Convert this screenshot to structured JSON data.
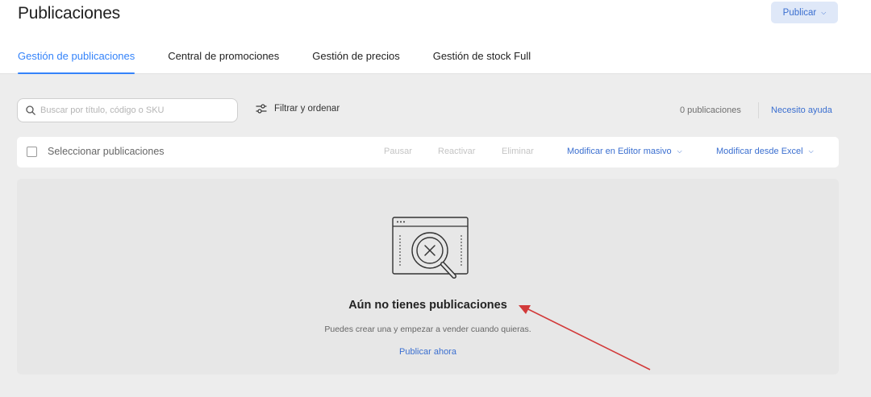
{
  "header": {
    "title": "Publicaciones",
    "publish_button": {
      "label": "Publicar",
      "icon": "chevron-down-icon"
    },
    "tabs": [
      {
        "label": "Gestión de publicaciones",
        "active": true
      },
      {
        "label": "Central de promociones",
        "active": false
      },
      {
        "label": "Gestión de precios",
        "active": false
      },
      {
        "label": "Gestión de stock Full",
        "active": false
      }
    ]
  },
  "search": {
    "placeholder": "Buscar por título, código o SKU",
    "value": "",
    "icon": "search-icon"
  },
  "filter": {
    "label": "Filtrar y ordenar",
    "icon": "sliders-icon"
  },
  "results": {
    "count_text": "0 publicaciones",
    "help_link": "Necesito ayuda"
  },
  "toolbar": {
    "select_label": "Seleccionar publicaciones",
    "actions": [
      "Pausar",
      "Reactivar",
      "Eliminar"
    ],
    "menus": [
      "Modificar en Editor masivo",
      "Modificar desde Excel"
    ]
  },
  "empty_state": {
    "illustration": "browser-magnifier-empty-icon",
    "title": "Aún no tienes publicaciones",
    "subtitle": "Puedes crear una y empezar a vender cuando quieras.",
    "link": "Publicar ahora"
  },
  "annotation": {
    "type": "red-arrow",
    "color": "#d23a3a"
  },
  "colors": {
    "accent": "#3483fa",
    "link": "#3b6fd0",
    "background": "#ededed"
  }
}
